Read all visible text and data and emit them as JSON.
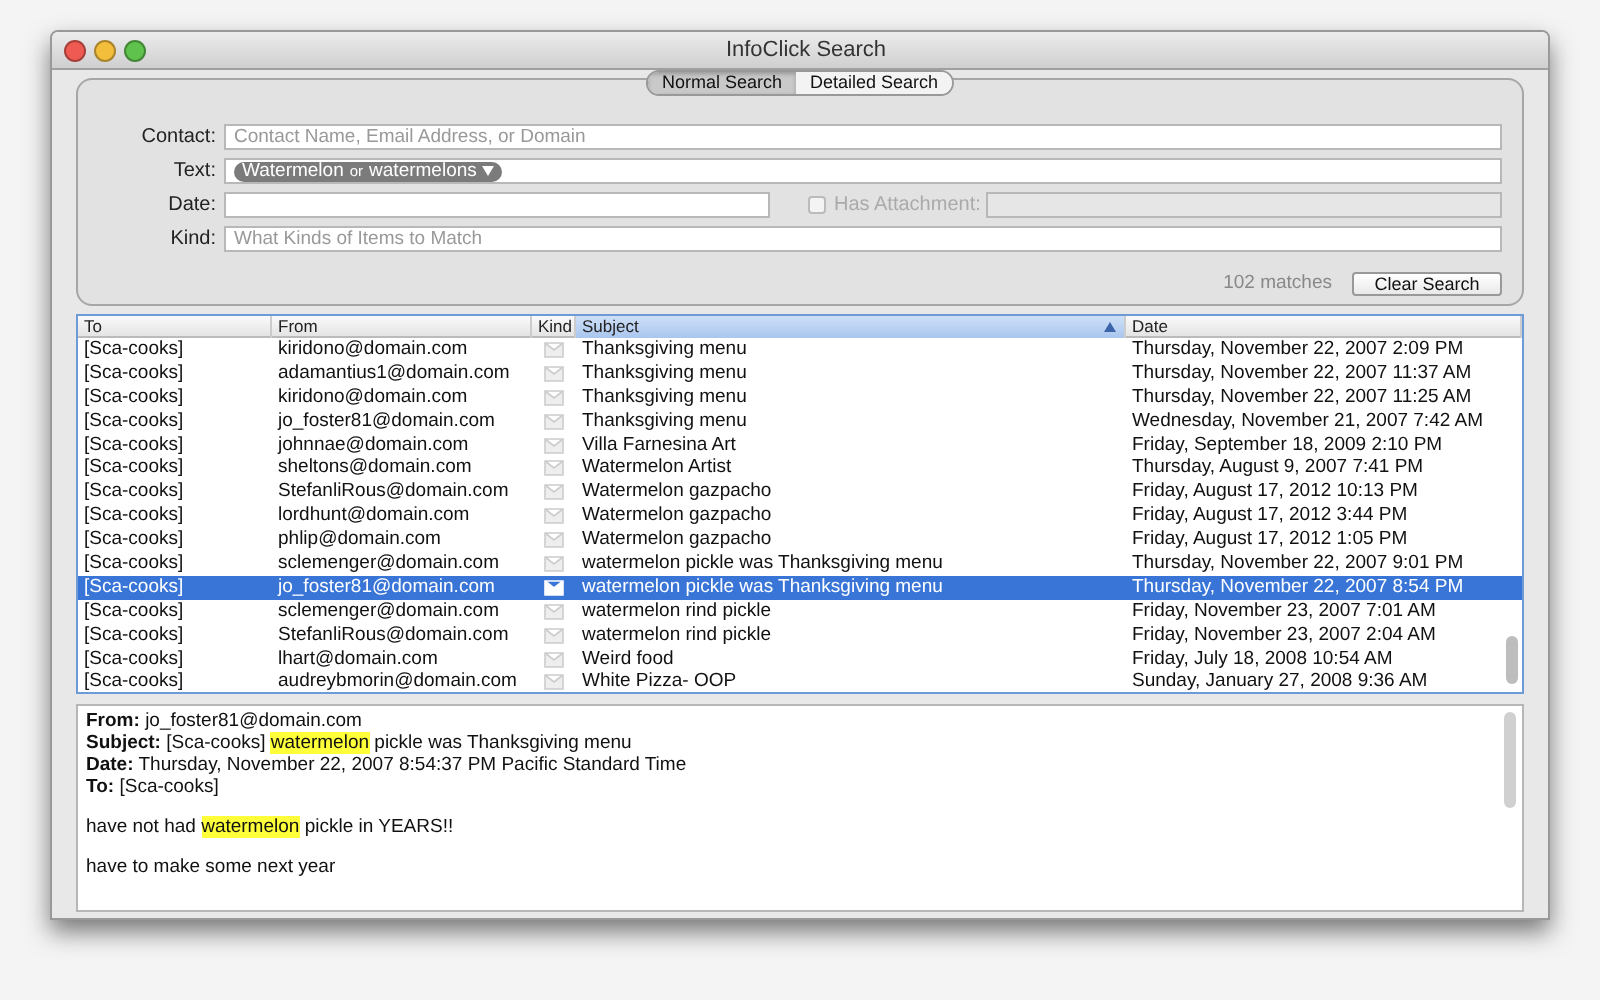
{
  "window": {
    "title": "InfoClick Search"
  },
  "search_tabs": [
    {
      "label": "Normal Search",
      "selected": true
    },
    {
      "label": "Detailed Search",
      "selected": false
    }
  ],
  "search_form": {
    "contact": {
      "label": "Contact:",
      "placeholder": "Contact Name, Email Address, or Domain"
    },
    "text": {
      "label": "Text:",
      "terms": [
        "Watermelon",
        "watermelons"
      ],
      "operator": "or"
    },
    "date": {
      "label": "Date:"
    },
    "has_attachment": {
      "label": "Has Attachment:",
      "checked": false,
      "disabled": true
    },
    "kind": {
      "label": "Kind:",
      "placeholder": "What Kinds of Items to Match"
    },
    "match_count": "102 matches",
    "clear_button": "Clear Search"
  },
  "table": {
    "columns": [
      {
        "label": "To",
        "sorted": false
      },
      {
        "label": "From",
        "sorted": false
      },
      {
        "label": "Kind",
        "sorted": false
      },
      {
        "label": "Subject",
        "sorted": true
      },
      {
        "label": "Date",
        "sorted": false
      }
    ],
    "rows": [
      {
        "to": "[Sca-cooks]",
        "from": "kiridono@domain.com",
        "subject": "Thanksgiving menu",
        "date": "Thursday, November 22, 2007 2:09 PM",
        "selected": false
      },
      {
        "to": "[Sca-cooks]",
        "from": "adamantius1@domain.com",
        "subject": "Thanksgiving menu",
        "date": "Thursday, November 22, 2007 11:37 AM",
        "selected": false
      },
      {
        "to": "[Sca-cooks]",
        "from": "kiridono@domain.com",
        "subject": "Thanksgiving menu",
        "date": "Thursday, November 22, 2007 11:25 AM",
        "selected": false
      },
      {
        "to": "[Sca-cooks]",
        "from": "jo_foster81@domain.com",
        "subject": "Thanksgiving menu",
        "date": "Wednesday, November 21, 2007 7:42 AM",
        "selected": false
      },
      {
        "to": "[Sca-cooks]",
        "from": "johnnae@domain.com",
        "subject": "Villa Farnesina Art",
        "date": "Friday, September 18, 2009 2:10 PM",
        "selected": false
      },
      {
        "to": "[Sca-cooks]",
        "from": "sheltons@domain.com",
        "subject": "Watermelon Artist",
        "date": "Thursday, August 9, 2007 7:41 PM",
        "selected": false
      },
      {
        "to": "[Sca-cooks]",
        "from": "StefanliRous@domain.com",
        "subject": "Watermelon gazpacho",
        "date": "Friday, August 17, 2012 10:13 PM",
        "selected": false
      },
      {
        "to": "[Sca-cooks]",
        "from": "lordhunt@domain.com",
        "subject": "Watermelon gazpacho",
        "date": "Friday, August 17, 2012 3:44 PM",
        "selected": false
      },
      {
        "to": "[Sca-cooks]",
        "from": "phlip@domain.com",
        "subject": "Watermelon gazpacho",
        "date": "Friday, August 17, 2012 1:05 PM",
        "selected": false
      },
      {
        "to": "[Sca-cooks]",
        "from": "sclemenger@domain.com",
        "subject": "watermelon pickle was Thanksgiving menu",
        "date": "Thursday, November 22, 2007 9:01 PM",
        "selected": false
      },
      {
        "to": "[Sca-cooks]",
        "from": "jo_foster81@domain.com",
        "subject": "watermelon pickle was Thanksgiving menu",
        "date": "Thursday, November 22, 2007 8:54 PM",
        "selected": true
      },
      {
        "to": "[Sca-cooks]",
        "from": "sclemenger@domain.com",
        "subject": "watermelon rind pickle",
        "date": "Friday, November 23, 2007 7:01 AM",
        "selected": false
      },
      {
        "to": "[Sca-cooks]",
        "from": "StefanliRous@domain.com",
        "subject": "watermelon rind pickle",
        "date": "Friday, November 23, 2007 2:04 AM",
        "selected": false
      },
      {
        "to": "[Sca-cooks]",
        "from": "lhart@domain.com",
        "subject": "Weird food",
        "date": "Friday, July 18, 2008 10:54 AM",
        "selected": false
      },
      {
        "to": "[Sca-cooks]",
        "from": "audreybmorin@domain.com",
        "subject": "White Pizza- OOP",
        "date": "Sunday, January 27, 2008 9:36 AM",
        "selected": false
      }
    ]
  },
  "preview": {
    "headers": [
      {
        "label": "From:",
        "segments": [
          {
            "text": "jo_foster81@domain.com",
            "highlight": false
          }
        ]
      },
      {
        "label": "Subject:",
        "segments": [
          {
            "text": "[Sca-cooks] ",
            "highlight": false
          },
          {
            "text": "watermelon",
            "highlight": true
          },
          {
            "text": " pickle was Thanksgiving menu",
            "highlight": false
          }
        ]
      },
      {
        "label": "Date:",
        "segments": [
          {
            "text": "Thursday, November 22, 2007 8:54:37 PM Pacific Standard Time",
            "highlight": false
          }
        ]
      },
      {
        "label": "To:",
        "segments": [
          {
            "text": "[Sca-cooks]",
            "highlight": false
          }
        ]
      }
    ],
    "body": [
      {
        "segments": [
          {
            "text": "have not had ",
            "highlight": false
          },
          {
            "text": "watermelon",
            "highlight": true
          },
          {
            "text": " pickle in YEARS!!",
            "highlight": false
          }
        ]
      },
      {
        "segments": [
          {
            "text": "have to make some next year",
            "highlight": false
          }
        ]
      }
    ]
  }
}
